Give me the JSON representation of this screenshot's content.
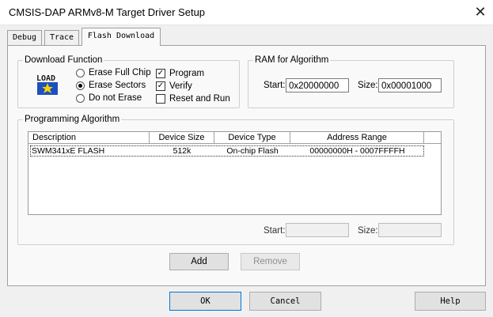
{
  "window": {
    "title": "CMSIS-DAP ARMv8-M Target Driver Setup",
    "close_glyph": "✕"
  },
  "tabs": [
    {
      "label": "Debug"
    },
    {
      "label": "Trace"
    },
    {
      "label": "Flash Download"
    }
  ],
  "download_function": {
    "legend": "Download Function",
    "icon_text": "LOAD",
    "radios": [
      {
        "label": "Erase Full Chip",
        "selected": false
      },
      {
        "label": "Erase Sectors",
        "selected": true
      },
      {
        "label": "Do not Erase",
        "selected": false
      }
    ],
    "checks": [
      {
        "label": "Program",
        "checked": true
      },
      {
        "label": "Verify",
        "checked": true
      },
      {
        "label": "Reset and Run",
        "checked": false
      }
    ]
  },
  "ram": {
    "legend": "RAM for Algorithm",
    "start_label": "Start:",
    "start_value": "0x20000000",
    "size_label": "Size:",
    "size_value": "0x00001000"
  },
  "programming": {
    "legend": "Programming Algorithm",
    "columns": [
      "Description",
      "Device Size",
      "Device Type",
      "Address Range"
    ],
    "rows": [
      {
        "description": "SWM341xE FLASH",
        "size": "512k",
        "type": "On-chip Flash",
        "range": "00000000H - 0007FFFFH"
      }
    ],
    "start_label": "Start:",
    "start_value": "",
    "size_label": "Size:",
    "size_value": ""
  },
  "buttons": {
    "add": "Add",
    "remove": "Remove",
    "ok": "OK",
    "cancel": "Cancel",
    "help": "Help"
  },
  "colors": {
    "focus_border": "#0078d7",
    "icon_blue": "#1f4fbf",
    "icon_yellow": "#f2d400"
  }
}
